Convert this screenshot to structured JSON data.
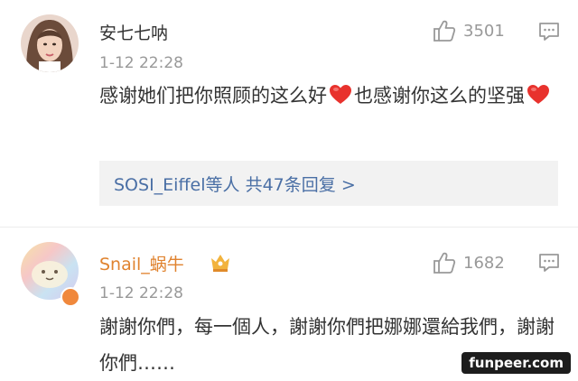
{
  "comments": [
    {
      "username": "安七七呐",
      "timestamp": "1-12 22:28",
      "likes": "3501",
      "text_part1": "感谢她们把你照顾的这么好",
      "text_part2": "也感谢你这么的坚强",
      "replies": {
        "users": "SOSI_Eiffel等人",
        "count": "共47条回复",
        "chevron": ">"
      }
    },
    {
      "username": "Snail_蜗牛",
      "timestamp": "1-12 22:28",
      "likes": "1682",
      "text": "謝謝你們，每一個人，謝謝你們把娜娜還給我們，謝謝你們……"
    }
  ],
  "watermark": "funpeer.com",
  "colors": {
    "username_vip": "#e0832f",
    "reply_link": "#4a6fa5",
    "heart": "#e8322d",
    "meta_gray": "#999999"
  },
  "icons": {
    "like": "thumbs-up-icon",
    "reply": "comment-bubble-icon",
    "heart": "heart-icon",
    "badge": "vip-badge-icon"
  }
}
